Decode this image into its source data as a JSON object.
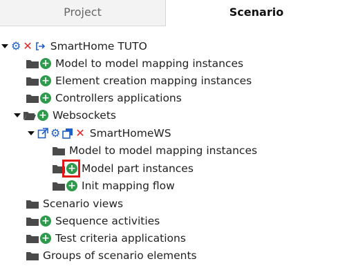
{
  "tabs": {
    "project": "Project",
    "scenario": "Scenario"
  },
  "tree": {
    "root": "SmartHome TUTO",
    "root_children": [
      "Model to model mapping instances",
      "Element creation mapping instances",
      "Controllers applications",
      "Websockets"
    ],
    "websocket_item": "SmartHomeWS",
    "ws_children": [
      "Model to model mapping instances",
      "Model part instances",
      "Init mapping flow"
    ],
    "bottom_items": [
      "Scenario views",
      "Sequence activities",
      "Test criteria applications",
      "Groups of scenario elements"
    ]
  },
  "colors": {
    "plus": "#2e9a4b",
    "accent": "#1f5fc7",
    "remove": "#e02424",
    "highlight": "#e01818"
  },
  "icons": [
    "folder-icon",
    "add-icon",
    "gear-icon",
    "remove-icon",
    "link-icon",
    "open-external-icon",
    "copy-icon"
  ]
}
